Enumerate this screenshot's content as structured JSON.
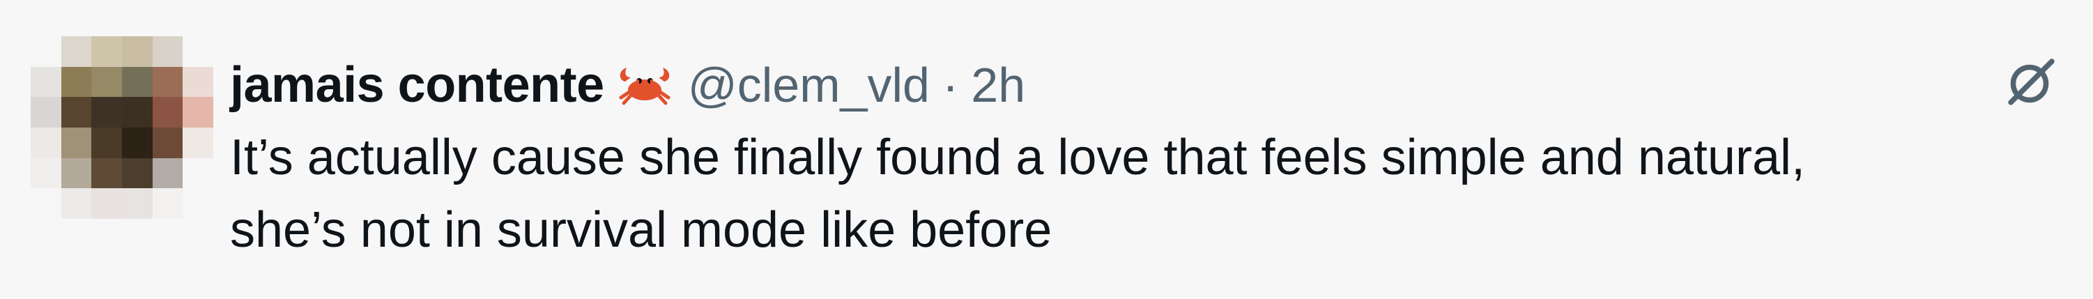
{
  "tweet": {
    "author_name": "jamais contente",
    "author_emoji": "crab",
    "handle": "@clem_vld",
    "separator": "·",
    "time": "2h",
    "text": "It’s actually cause she finally found a love that feels simple and natural,\nshe’s not in survival mode like before"
  },
  "icons": {
    "avatar": "pixelated-profile-photo",
    "emoji": "crab-icon",
    "action": "grok-icon"
  },
  "colors": {
    "background": "#f7f7f8",
    "primary_text": "#0f1419",
    "secondary_text": "#536471",
    "crab": "#e2512b"
  }
}
